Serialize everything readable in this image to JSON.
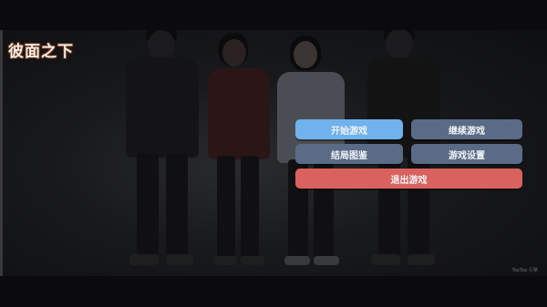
{
  "game": {
    "title": "彼面之下"
  },
  "menu": {
    "start": "开始游戏",
    "continue": "继续游戏",
    "endings": "结局图鉴",
    "settings": "游戏设置",
    "exit": "退出游戏"
  },
  "watermark": "TapTap 引擎",
  "colors": {
    "primary": "#6fb2ec",
    "secondary": "#5a6b86",
    "danger": "#d9625e",
    "background": "#0b0b0d"
  }
}
